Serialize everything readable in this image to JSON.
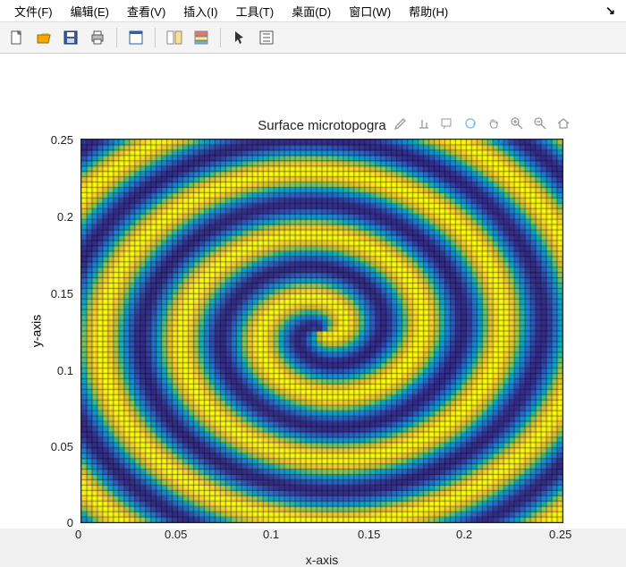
{
  "menu": {
    "items": [
      "文件(F)",
      "编辑(E)",
      "查看(V)",
      "插入(I)",
      "工具(T)",
      "桌面(D)",
      "窗口(W)",
      "帮助(H)"
    ],
    "arrow": "↘"
  },
  "toolbar": {
    "icons": [
      {
        "name": "new-file-icon"
      },
      {
        "name": "open-icon"
      },
      {
        "name": "save-icon"
      },
      {
        "name": "print-icon"
      },
      {
        "sep": true
      },
      {
        "name": "figure-icon"
      },
      {
        "sep": true
      },
      {
        "name": "panel-icon"
      },
      {
        "name": "panel2-icon"
      },
      {
        "sep": true
      },
      {
        "name": "pointer-icon"
      },
      {
        "name": "properties-icon"
      }
    ]
  },
  "chart_data": {
    "type": "heatmap",
    "title": "Surface microtopogra",
    "xlabel": "x-axis",
    "ylabel": "y-axis",
    "xlim": [
      0,
      0.25
    ],
    "ylim": [
      0,
      0.25
    ],
    "xticks": [
      0,
      0.05,
      0.1,
      0.15,
      0.2,
      0.25
    ],
    "yticks": [
      0,
      0.05,
      0.1,
      0.15,
      0.2,
      0.25
    ],
    "nx": 90,
    "ny": 72,
    "center": [
      0.125,
      0.125
    ],
    "spiral_wavenumber": 6,
    "grid": true,
    "colormap": "parula",
    "description": "Height field z = sin(6*pi*r/0.125 - theta), producing a spiral interference pattern across 90x72 cells with black gridlines."
  },
  "figure_tools": [
    {
      "name": "brush-icon",
      "label": "Brush"
    },
    {
      "name": "edit-plot-icon",
      "label": "Edit"
    },
    {
      "name": "data-tips-icon",
      "label": "Data tips"
    },
    {
      "name": "rotate3d-icon",
      "label": "Rotate"
    },
    {
      "name": "pan-icon",
      "label": "Pan"
    },
    {
      "name": "zoom-in-icon",
      "label": "Zoom in"
    },
    {
      "name": "zoom-out-icon",
      "label": "Zoom out"
    },
    {
      "name": "home-icon",
      "label": "Restore"
    }
  ]
}
